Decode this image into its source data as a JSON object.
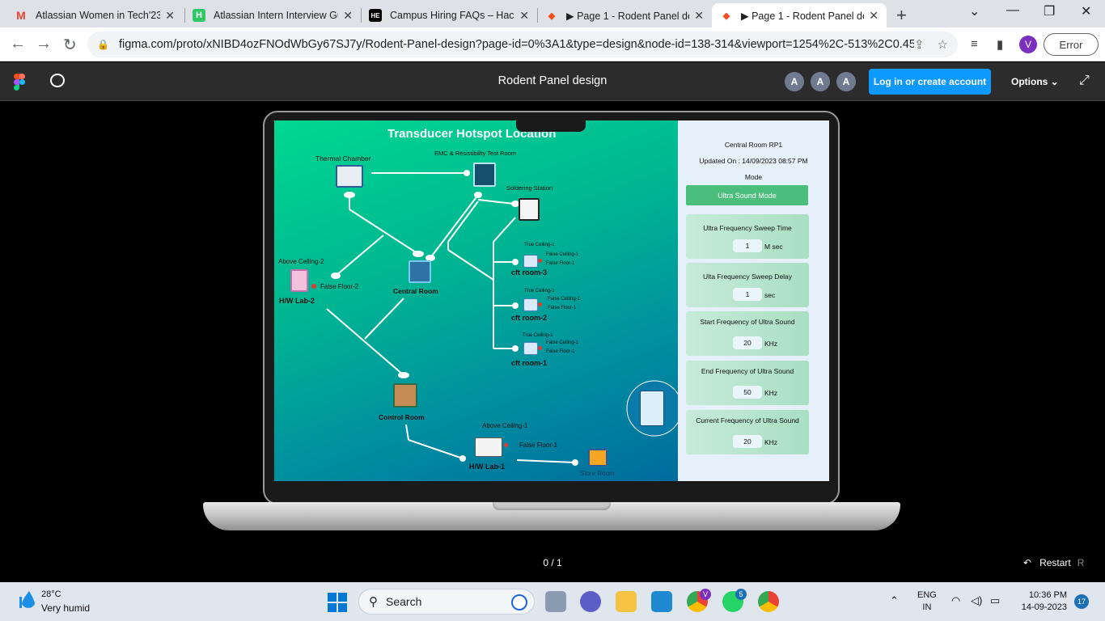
{
  "browser": {
    "tabs": [
      {
        "title": "Atlassian Women in Tech'23 ",
        "icon": "gmail-icon",
        "color": "#ea4335"
      },
      {
        "title": "Atlassian Intern Interview Gui",
        "icon": "hackerrank-icon",
        "color": "#2ec866"
      },
      {
        "title": "Campus Hiring FAQs – Hacke",
        "icon": "hackerearth-icon",
        "color": "#000000"
      },
      {
        "title": "▶ Page 1 - Rodent Panel des",
        "icon": "figma-icon",
        "color": "#f24e1e"
      },
      {
        "title": "▶ Page 1 - Rodent Panel des",
        "icon": "figma-icon",
        "color": "#f24e1e"
      }
    ],
    "url": "figma.com/proto/xNIBD4ozFNOdWbGy67SJ7y/Rodent-Panel-design?page-id=0%3A1&type=design&node-id=138-314&viewport=1254%2C-513%2C0.45&...",
    "profile_initial": "V",
    "error_label": "Error"
  },
  "figma": {
    "file_title": "Rodent Panel design",
    "avatars": [
      "A",
      "A",
      "A"
    ],
    "login_label": "Log in or create account",
    "options_label": "Options",
    "pager": "0 / 1",
    "restart_label": "Restart",
    "restart_key": "R"
  },
  "design": {
    "map_title": "Transducer Hotspot Location",
    "labels": {
      "thermal": "Thermal Chamber",
      "emc": "EMC & Resistibility Test Room",
      "soldering": "Soldering Station",
      "above_ceiling_2": "Above Celling-2",
      "false_floor_2": "False Floor-2",
      "hw_lab_2": "H/W Lab-2",
      "central_room": "Central Room",
      "true_ceiling": "True Ceiling-1",
      "false_ceiling": "False Ceiling-1",
      "false_floor_1": "False Floor-1",
      "cft3": "cft room-3",
      "cft2": "cft room-2",
      "cft1": "cft room-1",
      "control_room": "Control Room",
      "above_ceiling_1": "Above Ceiling-1",
      "false_floor_1b": "False Floor-1",
      "hw_lab_1": "H/W Lab-1",
      "store_room": "Store Room"
    },
    "panel": {
      "title": "Central Room RP1",
      "updated": "Updated On : 14/09/2023 08:57 PM",
      "mode_label": "Mode",
      "mode_value": "Ultra Sound Mode",
      "cards": [
        {
          "title": "Ultra Frequency Sweep Time",
          "value": "1",
          "unit": "M sec"
        },
        {
          "title": "Ulta Frequency Sweep Delay",
          "value": "1",
          "unit": "sec"
        },
        {
          "title": "Start Frequency of Ultra Sound",
          "value": "20",
          "unit": "KHz"
        },
        {
          "title": "End Frequency of Ultra Sound",
          "value": "50",
          "unit": "KHz"
        },
        {
          "title": "Current Frequency of Ultra Sound",
          "value": "20",
          "unit": "KHz"
        }
      ]
    }
  },
  "taskbar": {
    "temperature": "28°C",
    "weather": "Very humid",
    "search_label": "Search",
    "lang_top": "ENG",
    "lang_bottom": "IN",
    "time": "10:36 PM",
    "date": "14-09-2023",
    "notif_count": "17",
    "whatsapp_badge": "5"
  }
}
